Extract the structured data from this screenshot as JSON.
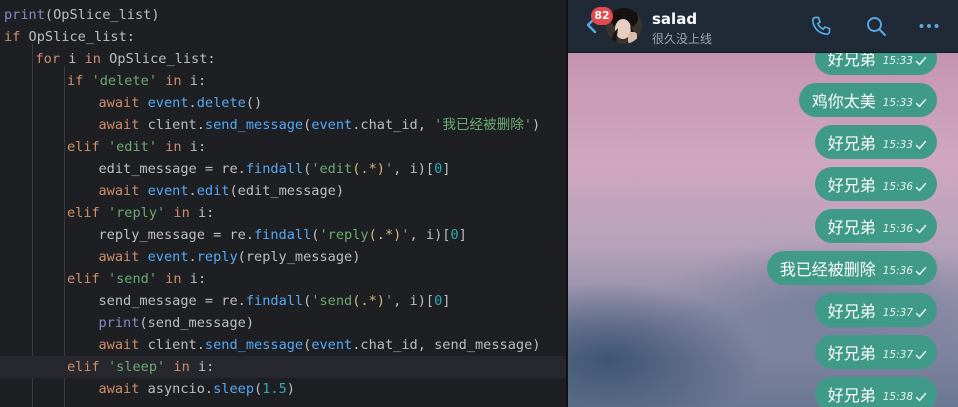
{
  "editor": {
    "lines": [
      {
        "indent": 0,
        "tokens": [
          {
            "t": "print",
            "c": "bi"
          },
          {
            "t": "(OpSlice_list)"
          }
        ]
      },
      {
        "indent": 0,
        "tokens": [
          {
            "t": "if",
            "c": "kw"
          },
          {
            "t": " OpSlice_list:"
          }
        ]
      },
      {
        "indent": 1,
        "tokens": [
          {
            "t": "for",
            "c": "kw"
          },
          {
            "t": " i "
          },
          {
            "t": "in",
            "c": "kw"
          },
          {
            "t": " OpSlice_list:"
          }
        ]
      },
      {
        "indent": 2,
        "tokens": [
          {
            "t": "if",
            "c": "kw"
          },
          {
            "t": " "
          },
          {
            "t": "'delete'",
            "c": "str"
          },
          {
            "t": " "
          },
          {
            "t": "in",
            "c": "kw"
          },
          {
            "t": " i:"
          }
        ]
      },
      {
        "indent": 3,
        "tokens": [
          {
            "t": "await",
            "c": "kw"
          },
          {
            "t": " event",
            "c": "fn2"
          },
          {
            "t": "."
          },
          {
            "t": "delete",
            "c": "fn"
          },
          {
            "t": "()"
          }
        ]
      },
      {
        "indent": 3,
        "tokens": [
          {
            "t": "await",
            "c": "kw"
          },
          {
            "t": " client."
          },
          {
            "t": "send_message",
            "c": "fn"
          },
          {
            "t": "("
          },
          {
            "t": "event",
            "c": "fn2"
          },
          {
            "t": ".chat_id, "
          },
          {
            "t": "'我已经被删除'",
            "c": "str"
          },
          {
            "t": ")"
          }
        ]
      },
      {
        "indent": 2,
        "tokens": [
          {
            "t": "elif",
            "c": "kw"
          },
          {
            "t": " "
          },
          {
            "t": "'edit'",
            "c": "str"
          },
          {
            "t": " "
          },
          {
            "t": "in",
            "c": "kw"
          },
          {
            "t": " i:"
          }
        ]
      },
      {
        "indent": 3,
        "tokens": [
          {
            "t": "edit_message = re."
          },
          {
            "t": "findall",
            "c": "fn"
          },
          {
            "t": "("
          },
          {
            "t": "'edit",
            "c": "str"
          },
          {
            "t": "(.*)",
            "c": "rx"
          },
          {
            "t": "'",
            "c": "str"
          },
          {
            "t": ", i)["
          },
          {
            "t": "0",
            "c": "num"
          },
          {
            "t": "]"
          }
        ]
      },
      {
        "indent": 3,
        "tokens": [
          {
            "t": "await",
            "c": "kw"
          },
          {
            "t": " event",
            "c": "fn2"
          },
          {
            "t": "."
          },
          {
            "t": "edit",
            "c": "fn"
          },
          {
            "t": "(edit_message)"
          }
        ]
      },
      {
        "indent": 2,
        "tokens": [
          {
            "t": "elif",
            "c": "kw"
          },
          {
            "t": " "
          },
          {
            "t": "'reply'",
            "c": "str"
          },
          {
            "t": " "
          },
          {
            "t": "in",
            "c": "kw"
          },
          {
            "t": " i:"
          }
        ]
      },
      {
        "indent": 3,
        "tokens": [
          {
            "t": "reply_message = re."
          },
          {
            "t": "findall",
            "c": "fn"
          },
          {
            "t": "("
          },
          {
            "t": "'reply",
            "c": "str"
          },
          {
            "t": "(.*)",
            "c": "rx"
          },
          {
            "t": "'",
            "c": "str"
          },
          {
            "t": ", i)["
          },
          {
            "t": "0",
            "c": "num"
          },
          {
            "t": "]"
          }
        ]
      },
      {
        "indent": 3,
        "tokens": [
          {
            "t": "await",
            "c": "kw"
          },
          {
            "t": " event",
            "c": "fn2"
          },
          {
            "t": "."
          },
          {
            "t": "reply",
            "c": "fn"
          },
          {
            "t": "(reply_message)"
          }
        ]
      },
      {
        "indent": 2,
        "tokens": [
          {
            "t": "elif",
            "c": "kw"
          },
          {
            "t": " "
          },
          {
            "t": "'send'",
            "c": "str"
          },
          {
            "t": " "
          },
          {
            "t": "in",
            "c": "kw"
          },
          {
            "t": " i:"
          }
        ]
      },
      {
        "indent": 3,
        "tokens": [
          {
            "t": "send_message = re."
          },
          {
            "t": "findall",
            "c": "fn"
          },
          {
            "t": "("
          },
          {
            "t": "'send",
            "c": "str"
          },
          {
            "t": "(.*)",
            "c": "rx"
          },
          {
            "t": "'",
            "c": "str"
          },
          {
            "t": ", i)["
          },
          {
            "t": "0",
            "c": "num"
          },
          {
            "t": "]"
          }
        ]
      },
      {
        "indent": 3,
        "tokens": [
          {
            "t": "print",
            "c": "bi"
          },
          {
            "t": "(send_message)"
          }
        ]
      },
      {
        "indent": 3,
        "tokens": [
          {
            "t": "await",
            "c": "kw"
          },
          {
            "t": " client."
          },
          {
            "t": "send_message",
            "c": "fn"
          },
          {
            "t": "("
          },
          {
            "t": "event",
            "c": "fn2"
          },
          {
            "t": ".chat_id, send_message)"
          }
        ]
      },
      {
        "indent": 2,
        "highlight": true,
        "tokens": [
          {
            "t": "elif",
            "c": "kw"
          },
          {
            "t": " "
          },
          {
            "t": "'sleep'",
            "c": "str"
          },
          {
            "t": " "
          },
          {
            "t": "in",
            "c": "kw"
          },
          {
            "t": " i:"
          }
        ]
      },
      {
        "indent": 3,
        "tokens": [
          {
            "t": "await",
            "c": "kw"
          },
          {
            "t": " asyncio."
          },
          {
            "t": "sleep",
            "c": "fn"
          },
          {
            "t": "("
          },
          {
            "t": "1.5",
            "c": "num"
          },
          {
            "t": ")"
          }
        ]
      }
    ]
  },
  "chat": {
    "unread_count": "82",
    "contact_name": "salad",
    "contact_status": "很久没上线",
    "icons": {
      "back": "chevron-left-icon",
      "call": "phone-icon",
      "search": "search-icon",
      "more": "more-icon"
    },
    "colors": {
      "header": "#1f2a36",
      "bubble": "#3f9b87",
      "accent": "#5aa7e6",
      "badge": "#e5484d"
    },
    "messages": [
      {
        "text": "好兄弟",
        "time": "15:33",
        "read": true
      },
      {
        "text": "鸡你太美",
        "time": "15:33",
        "read": true
      },
      {
        "text": "好兄弟",
        "time": "15:33",
        "read": true
      },
      {
        "text": "好兄弟",
        "time": "15:36",
        "read": true
      },
      {
        "text": "好兄弟",
        "time": "15:36",
        "read": true
      },
      {
        "text": "我已经被删除",
        "time": "15:36",
        "read": true
      },
      {
        "text": "好兄弟",
        "time": "15:37",
        "read": true
      },
      {
        "text": "好兄弟",
        "time": "15:37",
        "read": true
      },
      {
        "text": "好兄弟",
        "time": "15:38",
        "read": true
      }
    ]
  }
}
